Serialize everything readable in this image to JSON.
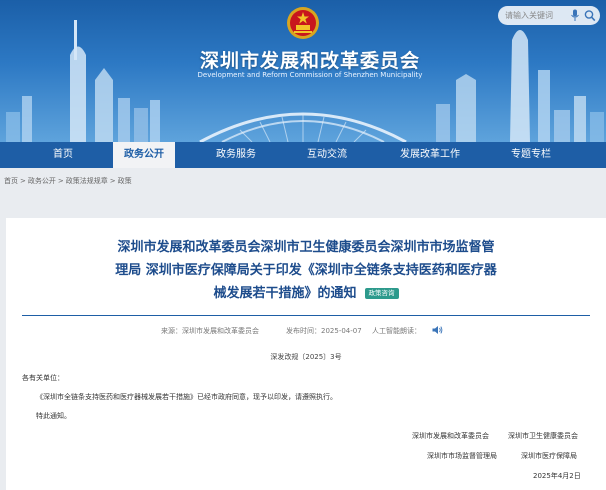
{
  "header": {
    "title": "深圳市发展和改革委员会",
    "subtitle": "Development and Reform Commission of Shenzhen Municipality",
    "search_placeholder": "请输入关键词"
  },
  "nav": {
    "items": [
      "首页",
      "政务公开",
      "政务服务",
      "互动交流",
      "发展改革工作",
      "专题专栏"
    ],
    "active": "政务公开"
  },
  "breadcrumb": [
    "首页",
    "政务公开",
    "政策法规规章",
    "政策"
  ],
  "article": {
    "title_lines": [
      "深圳市发展和改革委员会深圳市卫生健康委员会深圳市市场监督管",
      "理局 深圳市医疗保障局关于印发《深圳市全链条支持医药和医疗器",
      "械发展若干措施》的通知"
    ],
    "tag": "政策咨询",
    "source_label": "来源：",
    "source": "深圳市发展和改革委员会",
    "date_label": "发布时间：",
    "date": "2025-04-07",
    "ai_label": "人工智能朗读：",
    "doc_no": "深发改规〔2025〕3号",
    "salutation": "各有关单位：",
    "paragraph": "《深圳市全链条支持医药和医疗器械发展若干措施》已经市政府同意，现予以印发，请遵照执行。",
    "closing": "特此通知。",
    "signatories": [
      "深圳市发展和改革委员会",
      "深圳市卫生健康委员会",
      "深圳市市场监督管理局",
      "深圳市医疗保障局"
    ],
    "sign_date": "2025年4月2日"
  },
  "colors": {
    "nav": "#1e5ea6",
    "title": "#1d4c8c",
    "tag": "#2d9a8c"
  }
}
